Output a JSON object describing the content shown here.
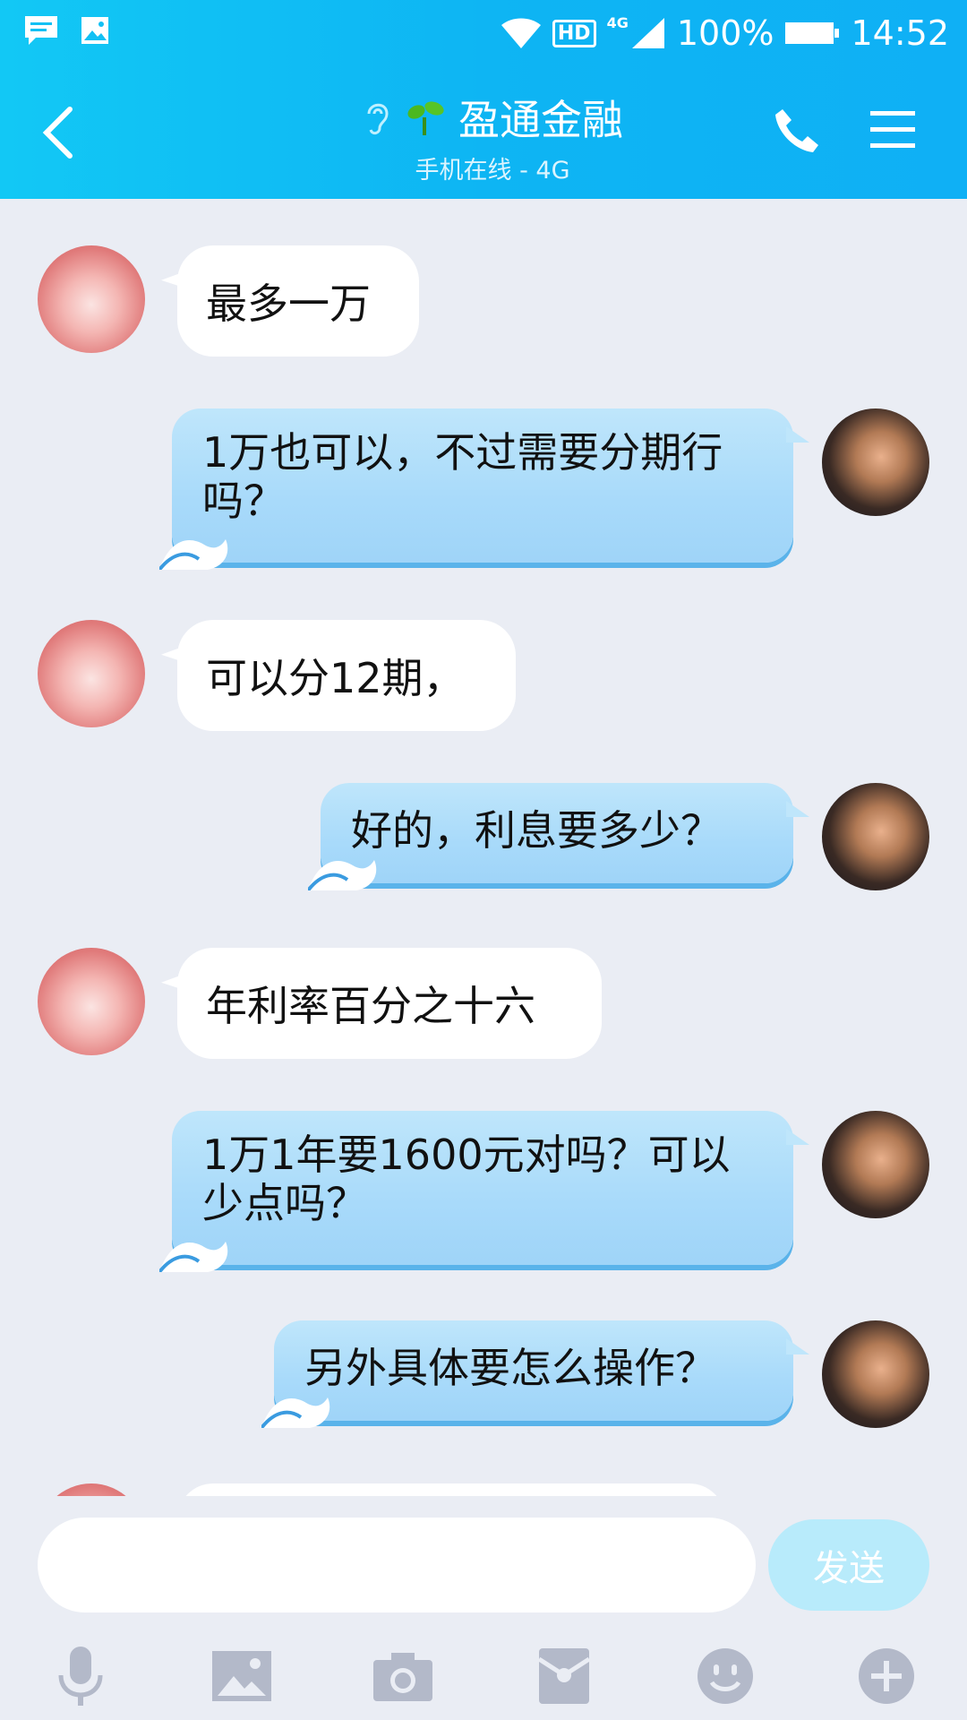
{
  "status_bar": {
    "battery": "100%",
    "time": "14:52",
    "hd_label": "HD",
    "network_label": "4G"
  },
  "header": {
    "title": "盈通金融",
    "subtitle": "手机在线 - 4G"
  },
  "messages": [
    {
      "side": "left",
      "text": "最多一万"
    },
    {
      "side": "right",
      "text": "1万也可以，不过需要分期行吗？"
    },
    {
      "side": "left",
      "text": "可以分12期，"
    },
    {
      "side": "right",
      "text": "好的，利息要多少？"
    },
    {
      "side": "left",
      "text": "年利率百分之十六"
    },
    {
      "side": "right",
      "text": "1万1年要1600元对吗？可以少点吗？"
    },
    {
      "side": "right",
      "text": "另外具体要怎么操作？"
    }
  ],
  "composer": {
    "input_value": "",
    "send_label": "发送"
  },
  "toolbar": [
    "mic-icon",
    "image-icon",
    "camera-icon",
    "red-packet-icon",
    "emoji-icon",
    "plus-icon"
  ],
  "colors": {
    "header": "#12c8f5",
    "bubble_right": "#a8dafa",
    "bubble_left": "#ffffff",
    "background": "#eaedf4",
    "send_button": "#b8ebfb"
  }
}
